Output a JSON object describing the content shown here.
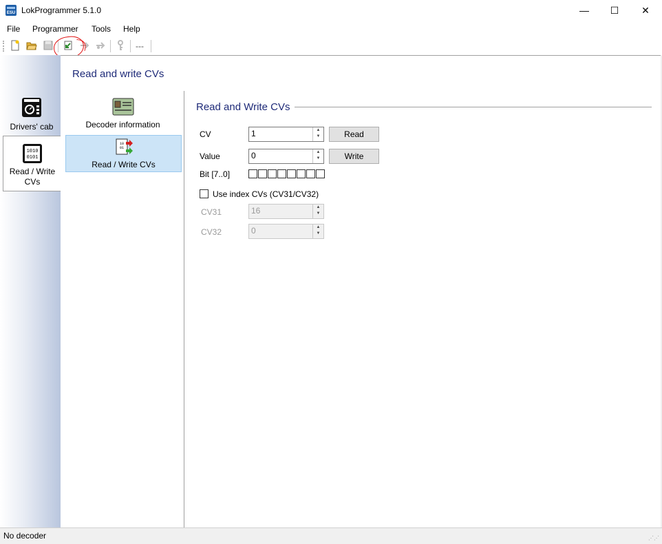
{
  "window": {
    "title": "LokProgrammer 5.1.0",
    "app_icon_text": "ESU",
    "min_glyph": "—",
    "max_glyph": "☐",
    "close_glyph": "✕"
  },
  "menu": {
    "file": "File",
    "programmer": "Programmer",
    "tools": "Tools",
    "help": "Help"
  },
  "toolbar": {
    "icons": [
      "new-file-icon",
      "open-folder-icon",
      "save-disk-icon",
      "read-decoder-icon",
      "write-decoder-icon",
      "write-sound-icon",
      "key-icon"
    ],
    "dash_text": "---",
    "annotation_color": "#e01010"
  },
  "navbar": {
    "drivers_cab_label": "Drivers' cab",
    "rw_label_line1": "Read / Write",
    "rw_label_line2": "CVs"
  },
  "header": {
    "title": "Read and write CVs"
  },
  "midlist": {
    "decoder_info_label": "Decoder information",
    "rw_cvs_label": "Read / Write CVs",
    "selected_color": "#cce4f7"
  },
  "main": {
    "section_title": "Read and Write CVs",
    "cv_label": "CV",
    "cv_value": "1",
    "read_button": "Read",
    "value_label": "Value",
    "value_value": "0",
    "write_button": "Write",
    "bit_label": "Bit [7..0]",
    "use_index_label": "Use index CVs (CV31/CV32)",
    "cv31_label": "CV31",
    "cv31_value": "16",
    "cv32_label": "CV32",
    "cv32_value": "0",
    "title_color": "#1e2a78"
  },
  "status": {
    "text": "No decoder"
  }
}
